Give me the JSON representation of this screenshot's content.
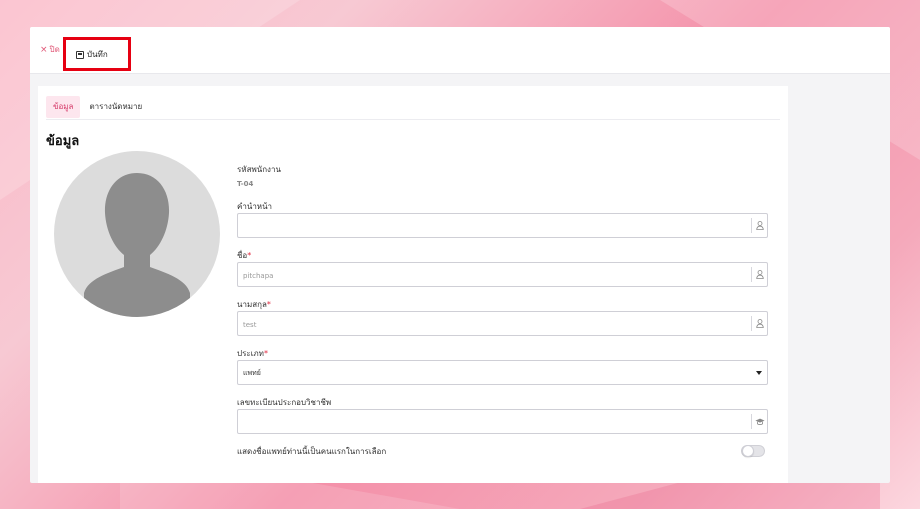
{
  "toolbar": {
    "close_label": "ปิด",
    "save_label": "บันทึก"
  },
  "tabs": [
    {
      "label": "ข้อมูล",
      "active": true
    },
    {
      "label": "ตารางนัดหมาย",
      "active": false
    }
  ],
  "section_title": "ข้อมูล",
  "form": {
    "employee_code_label": "รหัสพนักงาน",
    "employee_code_value": "T-04",
    "prefix_label": "คำนำหน้า",
    "prefix_value": "",
    "first_name_label": "ชื่อ",
    "first_name_value": "pitchapa",
    "last_name_label": "นามสกุล",
    "last_name_value": "test",
    "type_label": "ประเภท",
    "type_value": "แพทย์",
    "license_label": "เลขทะเบียนประกอบวิชาชีพ",
    "license_value": "",
    "show_first_label": "แสดงชื่อแพทย์ท่านนี้เป็นคนแรกในการเลือก",
    "show_first_on": false,
    "required_mark": "*"
  },
  "colors": {
    "accent": "#d63b6a",
    "highlight_border": "#e60012"
  }
}
